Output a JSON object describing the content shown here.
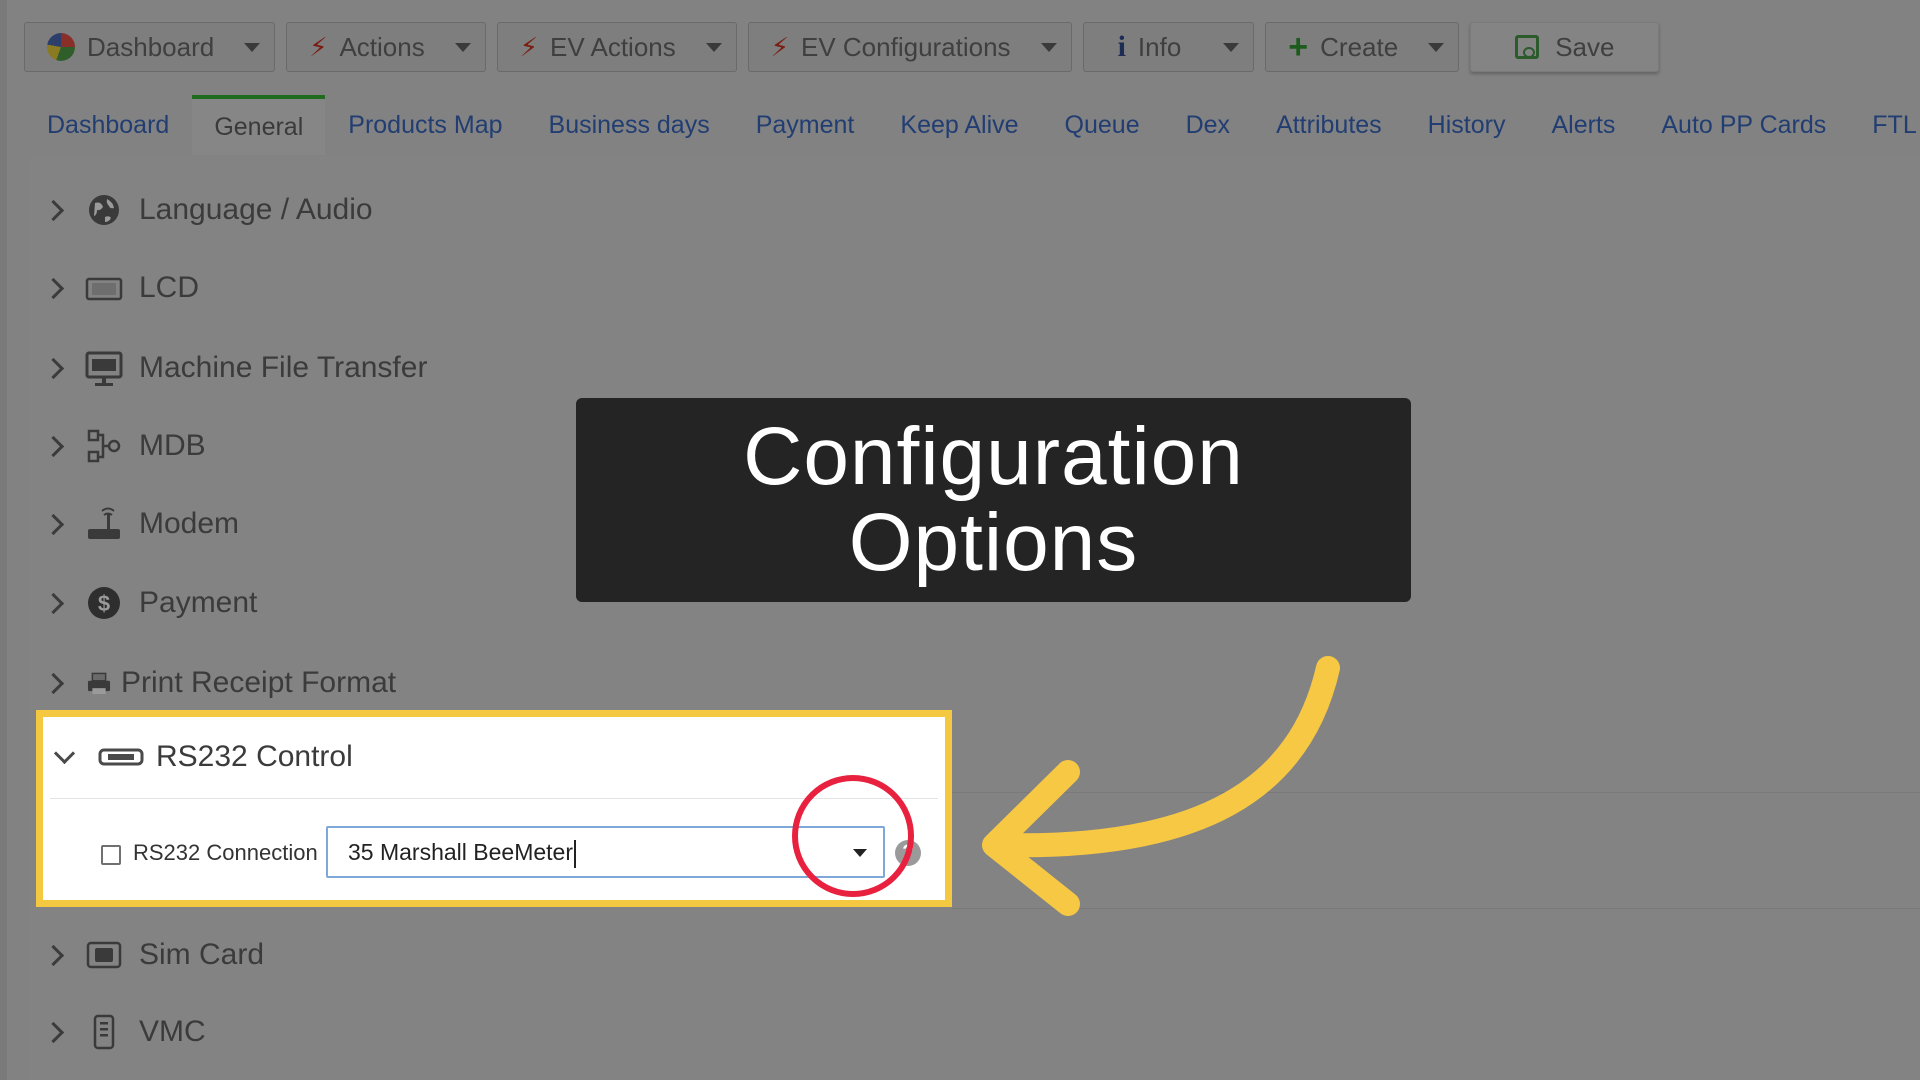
{
  "toolbar": {
    "buttons": [
      {
        "label": "Dashboard",
        "icon": "pie-chart-icon"
      },
      {
        "label": "Actions",
        "icon": "bolt-icon"
      },
      {
        "label": "EV Actions",
        "icon": "bolt-icon"
      },
      {
        "label": "EV Configurations",
        "icon": "bolt-icon"
      },
      {
        "label": "Info",
        "icon": "info-icon"
      },
      {
        "label": "Create",
        "icon": "plus-icon"
      }
    ],
    "save_label": "Save"
  },
  "tabs": [
    {
      "label": "Dashboard"
    },
    {
      "label": "General",
      "active": true
    },
    {
      "label": "Products Map"
    },
    {
      "label": "Business days"
    },
    {
      "label": "Payment"
    },
    {
      "label": "Keep Alive"
    },
    {
      "label": "Queue"
    },
    {
      "label": "Dex"
    },
    {
      "label": "Attributes"
    },
    {
      "label": "History"
    },
    {
      "label": "Alerts"
    },
    {
      "label": "Auto PP Cards"
    },
    {
      "label": "FTL"
    }
  ],
  "tree": {
    "items": [
      {
        "label": "Language / Audio",
        "icon": "globe-icon"
      },
      {
        "label": "LCD",
        "icon": "lcd-icon"
      },
      {
        "label": "Machine File Transfer",
        "icon": "ftp-icon"
      },
      {
        "label": "MDB",
        "icon": "mdb-icon"
      },
      {
        "label": "Modem",
        "icon": "modem-icon"
      },
      {
        "label": "Payment",
        "icon": "dollar-icon"
      },
      {
        "label": "Print Receipt Format",
        "icon": "printer-icon"
      },
      {
        "label": "RS232 Control",
        "icon": "serial-port-icon",
        "expanded": true
      },
      {
        "label": "Sim Card",
        "icon": "sim-card-icon"
      },
      {
        "label": "VMC",
        "icon": "vmc-icon"
      }
    ],
    "rs232": {
      "connection_label": "RS232 Connection",
      "connection_value": "35 Marshall BeeMeter",
      "checked": false
    }
  },
  "overlay": {
    "line1": "Configuration",
    "line2": "Options"
  },
  "colors": {
    "highlight": "#f5c842",
    "red_circle": "#e8213f",
    "banner_bg": "#242424",
    "tab_link": "#213d72"
  }
}
